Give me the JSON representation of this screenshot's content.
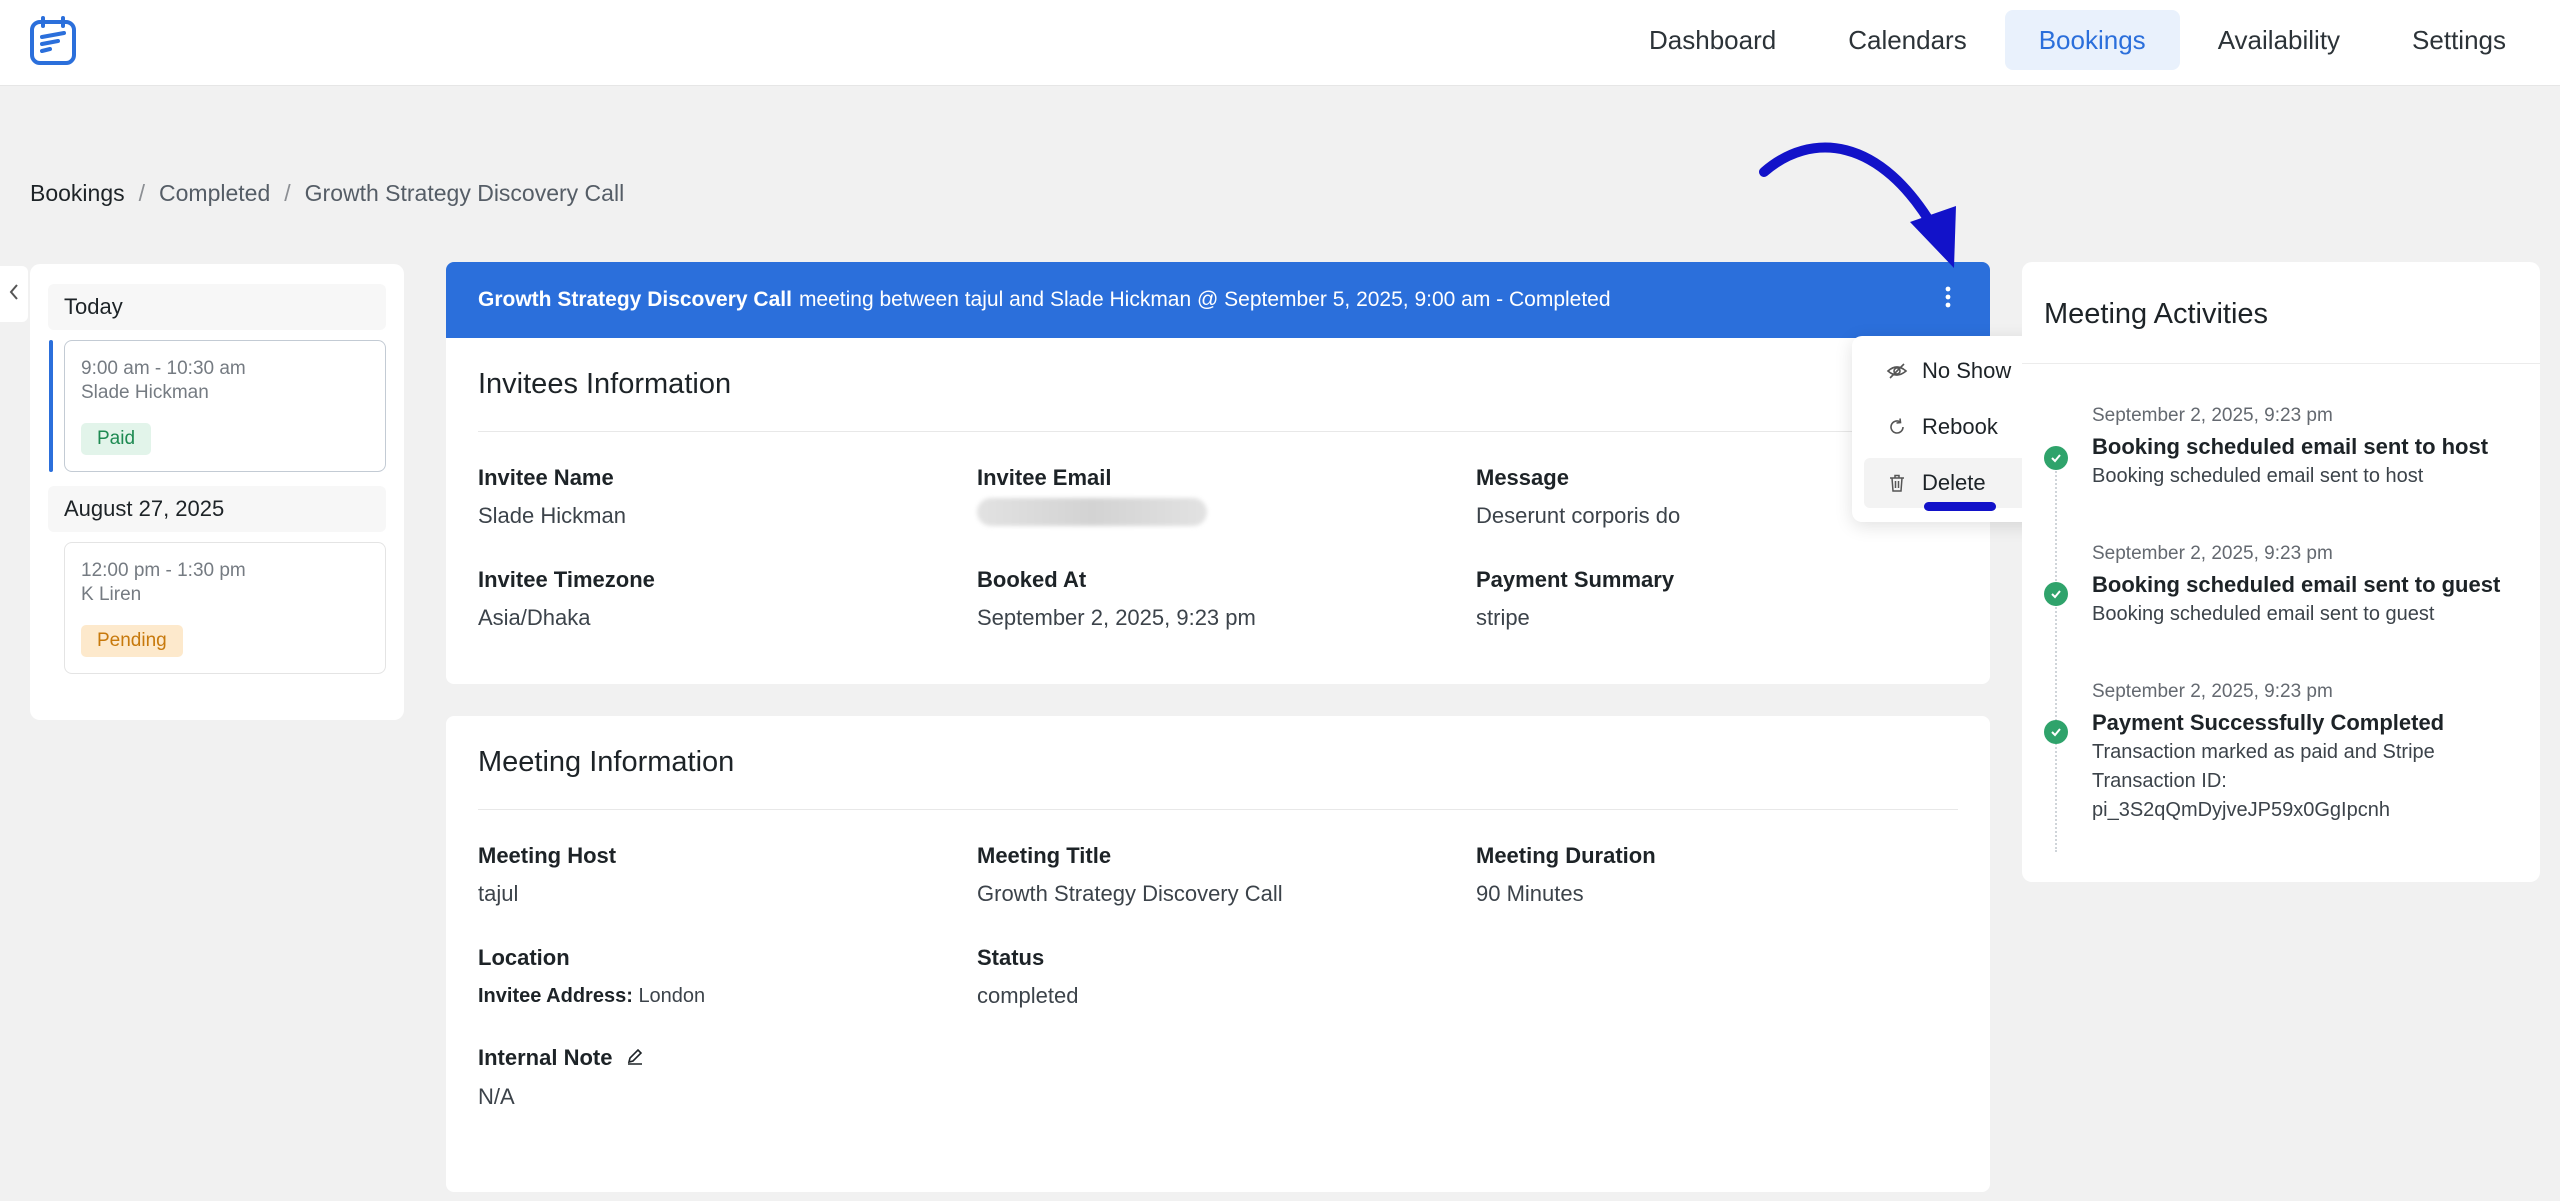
{
  "nav": {
    "items": [
      {
        "label": "Dashboard",
        "active": false
      },
      {
        "label": "Calendars",
        "active": false
      },
      {
        "label": "Bookings",
        "active": true
      },
      {
        "label": "Availability",
        "active": false
      },
      {
        "label": "Settings",
        "active": false
      }
    ]
  },
  "breadcrumb": [
    "Bookings",
    "Completed",
    "Growth Strategy Discovery Call"
  ],
  "sidebar": {
    "groups": [
      {
        "day": "Today",
        "slots": [
          {
            "time": "9:00 am - 10:30 am",
            "name": "Slade Hickman",
            "status": "Paid"
          }
        ]
      },
      {
        "day": "August 27, 2025",
        "slots": [
          {
            "time": "12:00 pm - 1:30 pm",
            "name": "K Liren",
            "status": "Pending"
          }
        ]
      }
    ]
  },
  "header": {
    "event_name": "Growth Strategy Discovery Call",
    "summary": "meeting between tajul and Slade Hickman @ September 5, 2025, 9:00 am - Completed"
  },
  "invitees": {
    "title": "Invitees Information",
    "fields": {
      "name_label": "Invitee Name",
      "name_value": "Slade Hickman",
      "email_label": "Invitee Email",
      "message_label": "Message",
      "message_value": "Deserunt corporis do",
      "timezone_label": "Invitee Timezone",
      "timezone_value": "Asia/Dhaka",
      "booked_label": "Booked At",
      "booked_value": "September 2, 2025, 9:23 pm",
      "payment_label": "Payment Summary",
      "payment_value": "stripe"
    }
  },
  "meeting": {
    "title": "Meeting Information",
    "fields": {
      "host_label": "Meeting Host",
      "host_value": "tajul",
      "mtitle_label": "Meeting Title",
      "mtitle_value": "Growth Strategy Discovery Call",
      "duration_label": "Meeting Duration",
      "duration_value": "90 Minutes",
      "location_label": "Location",
      "address_label": "Invitee Address:",
      "address_value": "London",
      "status_label": "Status",
      "status_value": "completed",
      "note_label": "Internal Note",
      "note_value": "N/A"
    }
  },
  "dropdown": {
    "items": [
      {
        "label": "No Show",
        "icon": "eye-slash-icon"
      },
      {
        "label": "Rebook",
        "icon": "refresh-icon"
      },
      {
        "label": "Delete",
        "icon": "trash-icon"
      }
    ]
  },
  "activities": {
    "title": "Meeting Activities",
    "items": [
      {
        "time": "September 2, 2025, 9:23 pm",
        "title": "Booking scheduled email sent to host",
        "desc": "Booking scheduled email sent to host"
      },
      {
        "time": "September 2, 2025, 9:23 pm",
        "title": "Booking scheduled email sent to guest",
        "desc": "Booking scheduled email sent to guest"
      },
      {
        "time": "September 2, 2025, 9:23 pm",
        "title": "Payment Successfully Completed",
        "desc": "Transaction marked as paid and Stripe Transaction ID: pi_3S2qQmDyjveJP59x0GgIpcnh"
      }
    ]
  },
  "colors": {
    "accent": "#2b6fdb",
    "success": "#2fa36b",
    "annotation": "#1212c9"
  }
}
